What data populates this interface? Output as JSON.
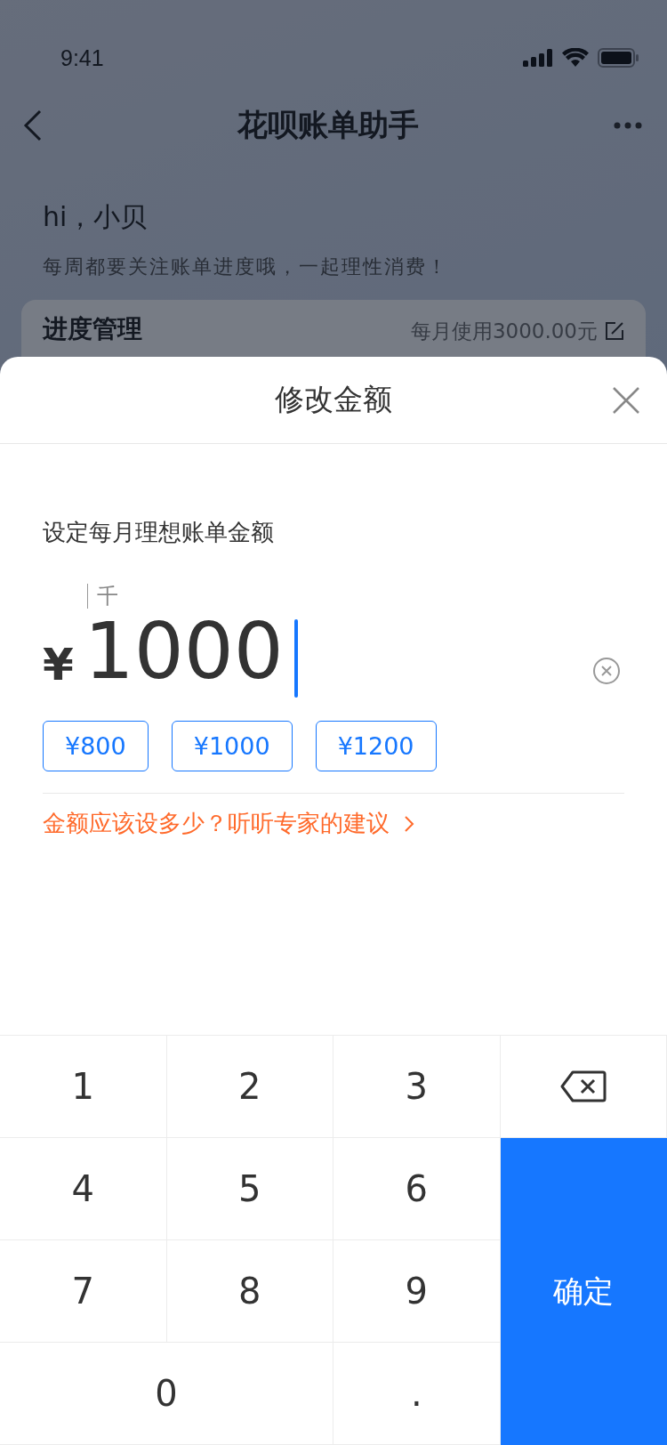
{
  "status_bar": {
    "time": "9:41"
  },
  "nav": {
    "title": "花呗账单助手"
  },
  "greeting": {
    "title": "hi，小贝",
    "subtitle": "每周都要关注账单进度哦，一起理性消费！"
  },
  "progress_card": {
    "title": "进度管理",
    "summary": "每月使用3000.00元"
  },
  "sheet": {
    "title": "修改金额",
    "label": "设定每月理想账单金额",
    "currency": "¥",
    "unit_hint": "千",
    "value": "1000",
    "presets": [
      {
        "label": "¥800"
      },
      {
        "label": "¥1000"
      },
      {
        "label": "¥1200"
      }
    ],
    "advice_link": "金额应该设多少？听听专家的建议"
  },
  "keypad": [
    {
      "kind": "digit",
      "label": "1"
    },
    {
      "kind": "digit",
      "label": "2"
    },
    {
      "kind": "digit",
      "label": "3"
    },
    {
      "kind": "backspace"
    },
    {
      "kind": "digit",
      "label": "4"
    },
    {
      "kind": "digit",
      "label": "5"
    },
    {
      "kind": "digit",
      "label": "6"
    },
    {
      "kind": "digit",
      "label": "7"
    },
    {
      "kind": "digit",
      "label": "8"
    },
    {
      "kind": "digit",
      "label": "9"
    },
    {
      "kind": "confirm",
      "label": "确定"
    },
    {
      "kind": "wide",
      "label": "0"
    },
    {
      "kind": "digit",
      "label": "."
    }
  ]
}
